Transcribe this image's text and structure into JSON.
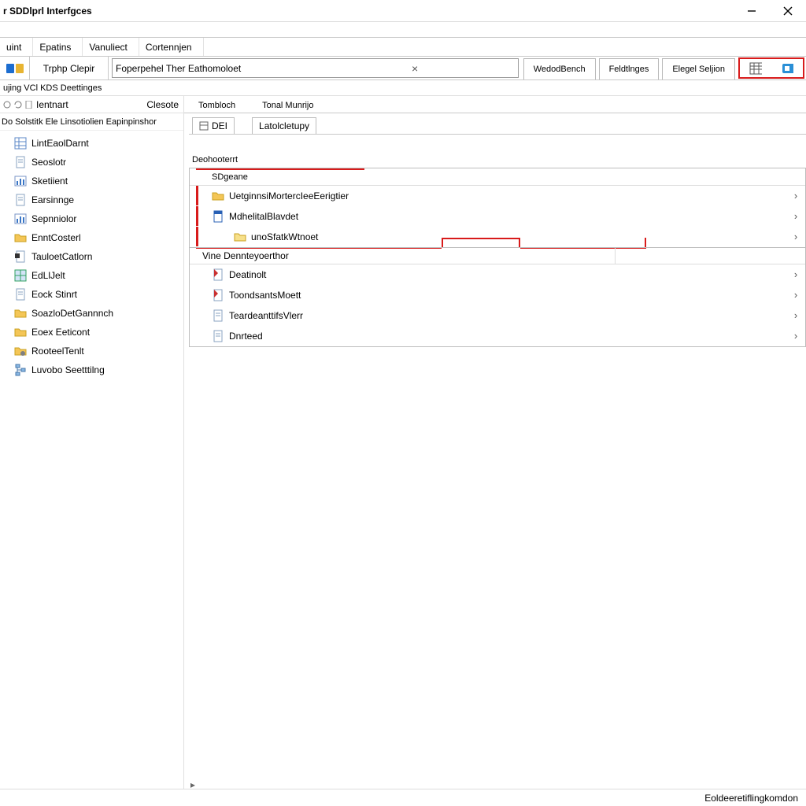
{
  "title": "r SDDlprl Interfgces",
  "menu": [
    "uint",
    "Epatins",
    "Vanuliect",
    "Cortennjen"
  ],
  "toolrow": {
    "history_label": "Trphp Clepir",
    "address_text": "Foperpehel  Ther Eathomoloet"
  },
  "right_tabs": [
    "WedodBench",
    "Feldtlnges",
    "Elegel Seljion"
  ],
  "crumb": "ujing VCl KDS Deettinges",
  "side": {
    "header_left": "Ientnart",
    "header_right": "Clesote",
    "subhead": "Do Solstitk Ele Linsotiolien Eapinpinshor",
    "items": [
      {
        "label": "LintEaolDarnt",
        "icon": "grid"
      },
      {
        "label": "Seoslotr",
        "icon": "doc"
      },
      {
        "label": "Sketiient",
        "icon": "bars"
      },
      {
        "label": "Earsinnge",
        "icon": "doc"
      },
      {
        "label": "Sepnniolor",
        "icon": "bars"
      },
      {
        "label": "EnntCosterl",
        "icon": "folder"
      },
      {
        "label": "TauloetCatlorn",
        "icon": "doc-mark"
      },
      {
        "label": "EdLlJelt",
        "icon": "grid-blue"
      },
      {
        "label": "Eock Stinrt",
        "icon": "doc"
      },
      {
        "label": "SoazloDetGannnch",
        "icon": "folder"
      },
      {
        "label": "Eoex Eeticont",
        "icon": "folder"
      },
      {
        "label": "RooteelTenlt",
        "icon": "folder-gear"
      },
      {
        "label": "Luvobo Seetttilng",
        "icon": "tree"
      }
    ]
  },
  "main": {
    "top_tabs": [
      "Tombloch",
      "Tonal Munrijo"
    ],
    "sub_tabs": [
      "DEI",
      "Latolcletupy"
    ],
    "section1": {
      "label": "Deohooterrt",
      "colhdr": "SDgeane",
      "rows": [
        {
          "label": "UetginnsiMortercIeeEerigtier",
          "icon": "folder"
        },
        {
          "label": "MdhelitalBlavdet",
          "icon": "doc-blue"
        },
        {
          "label": "unoSfatkWtnoet",
          "icon": "folder-y"
        }
      ]
    },
    "section2": {
      "label": "Vine Dennteyoerthor",
      "rows": [
        {
          "label": "Deatinolt",
          "icon": "doc-red"
        },
        {
          "label": "ToondsantsMoett",
          "icon": "doc-red"
        },
        {
          "label": "TeardeanttifsVlerr",
          "icon": "doc"
        },
        {
          "label": "Dnrteed",
          "icon": "doc"
        }
      ]
    }
  },
  "status": "Eoldeeretiflingkomdon"
}
